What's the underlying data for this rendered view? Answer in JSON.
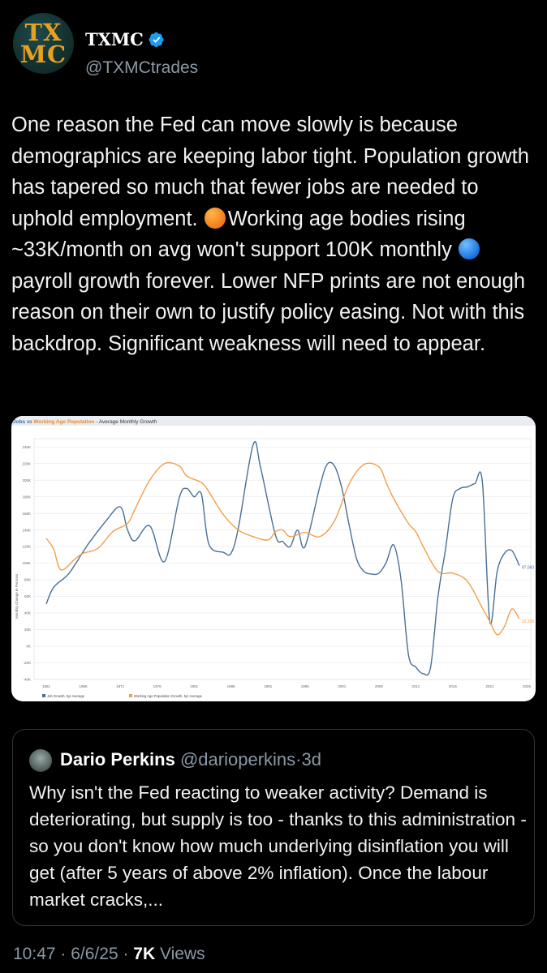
{
  "author": {
    "avatar_line1": "TX",
    "avatar_line2": "MC",
    "name": "TXMC",
    "handle": "@TXMCtrades",
    "verified": true
  },
  "tweet": {
    "text_part1": "One reason the Fed can move slowly is because demographics are keeping labor tight. Population growth has tapered so much that fewer jobs are needed to uphold employment. ",
    "emoji1": "orange-circle",
    "text_part2": "Working age bodies rising ~33K/month on avg won't support 100K monthly ",
    "emoji2": "blue-circle",
    "text_part3": "payroll growth forever. Lower NFP prints are not enough reason on their own to justify policy easing. Not with this backdrop. Significant weakness will need to appear."
  },
  "chart_data": {
    "type": "line",
    "title_part1": "Jobs",
    "title_sep": " vs ",
    "title_part2": "Working Age Population",
    "title_part3": " - Average Monthly Growth",
    "ylabel": "Monthly Change in Persons",
    "ylim": [
      -40000,
      250000
    ],
    "y_ticks": [
      "240K",
      "220K",
      "200K",
      "180K",
      "160K",
      "140K",
      "120K",
      "100K",
      "80K",
      "60K",
      "40K",
      "20K",
      "0K",
      "-20K",
      "-40K"
    ],
    "x_ticks": [
      "1961",
      "1966",
      "1971",
      "1976",
      "1981",
      "1986",
      "1991",
      "1996",
      "2001",
      "2006",
      "2011",
      "2016",
      "2021",
      "2026"
    ],
    "xlim": [
      1961,
      2026
    ],
    "grid": true,
    "legend_position": "bottom-left",
    "series": [
      {
        "name": "Job Growth, 5yr Average",
        "color": "#4a6f94",
        "end_label": "97,063",
        "points": [
          [
            1961,
            51000
          ],
          [
            1962,
            71000
          ],
          [
            1964,
            87000
          ],
          [
            1966,
            114000
          ],
          [
            1967,
            127000
          ],
          [
            1969,
            150000
          ],
          [
            1971,
            168000
          ],
          [
            1972,
            140000
          ],
          [
            1973,
            127000
          ],
          [
            1975,
            145000
          ],
          [
            1977,
            102000
          ],
          [
            1979,
            179000
          ],
          [
            1980,
            190000
          ],
          [
            1981,
            180000
          ],
          [
            1982,
            183000
          ],
          [
            1983,
            123000
          ],
          [
            1985,
            113000
          ],
          [
            1986,
            112000
          ],
          [
            1987,
            143000
          ],
          [
            1989,
            243000
          ],
          [
            1990,
            215000
          ],
          [
            1992,
            134000
          ],
          [
            1993,
            126000
          ],
          [
            1994,
            120000
          ],
          [
            1995,
            140000
          ],
          [
            1996,
            120000
          ],
          [
            1998,
            192000
          ],
          [
            1999,
            219000
          ],
          [
            2000,
            217000
          ],
          [
            2001,
            190000
          ],
          [
            2002,
            145000
          ],
          [
            2003,
            105000
          ],
          [
            2004,
            90000
          ],
          [
            2005,
            87000
          ],
          [
            2006,
            88000
          ],
          [
            2007,
            101000
          ],
          [
            2008,
            122000
          ],
          [
            2009,
            80000
          ],
          [
            2010,
            -10000
          ],
          [
            2011,
            -25000
          ],
          [
            2012,
            -33000
          ],
          [
            2013,
            -25000
          ],
          [
            2014,
            60000
          ],
          [
            2015,
            116000
          ],
          [
            2016,
            178000
          ],
          [
            2017,
            190000
          ],
          [
            2018,
            192000
          ],
          [
            2019,
            196000
          ],
          [
            2020,
            198000
          ],
          [
            2021,
            30000
          ],
          [
            2022,
            90000
          ],
          [
            2023,
            112000
          ],
          [
            2024,
            115000
          ],
          [
            2025,
            97000
          ]
        ]
      },
      {
        "name": "Working Age Population Growth, 5yr Average",
        "color": "#f0a04a",
        "end_label": "32,326",
        "points": [
          [
            1961,
            130000
          ],
          [
            1962,
            117000
          ],
          [
            1963,
            92000
          ],
          [
            1965,
            106000
          ],
          [
            1966,
            112000
          ],
          [
            1968,
            118000
          ],
          [
            1970,
            138000
          ],
          [
            1972,
            148000
          ],
          [
            1973,
            165000
          ],
          [
            1975,
            200000
          ],
          [
            1977,
            220000
          ],
          [
            1979,
            217000
          ],
          [
            1980,
            205000
          ],
          [
            1982,
            197000
          ],
          [
            1983,
            186000
          ],
          [
            1985,
            158000
          ],
          [
            1987,
            140000
          ],
          [
            1989,
            132000
          ],
          [
            1991,
            128000
          ],
          [
            1992,
            138000
          ],
          [
            1993,
            140000
          ],
          [
            1994,
            132000
          ],
          [
            1996,
            137000
          ],
          [
            1998,
            132000
          ],
          [
            2000,
            151000
          ],
          [
            2002,
            196000
          ],
          [
            2004,
            219000
          ],
          [
            2006,
            216000
          ],
          [
            2007,
            197000
          ],
          [
            2008,
            178000
          ],
          [
            2010,
            148000
          ],
          [
            2011,
            138000
          ],
          [
            2012,
            120000
          ],
          [
            2014,
            90000
          ],
          [
            2016,
            88000
          ],
          [
            2018,
            78000
          ],
          [
            2020,
            46000
          ],
          [
            2021,
            30000
          ],
          [
            2022,
            14000
          ],
          [
            2023,
            24000
          ],
          [
            2024,
            45000
          ],
          [
            2025,
            33000
          ]
        ]
      }
    ]
  },
  "quote": {
    "name": "Dario Perkins",
    "handle": "@darioperkins",
    "separator": "·",
    "time": "3d",
    "text": "Why isn't the Fed reacting to weaker activity? Demand is deteriorating, but supply is too - thanks to this administration - so you don't know how much underlying disinflation you will get (after 5 years of above 2% inflation). Once the labour market cracks,..."
  },
  "footer": {
    "time": "10:47",
    "sep1": " · ",
    "date": "6/6/25",
    "sep2": " · ",
    "views_count": "7K",
    "views_label": " Views"
  }
}
